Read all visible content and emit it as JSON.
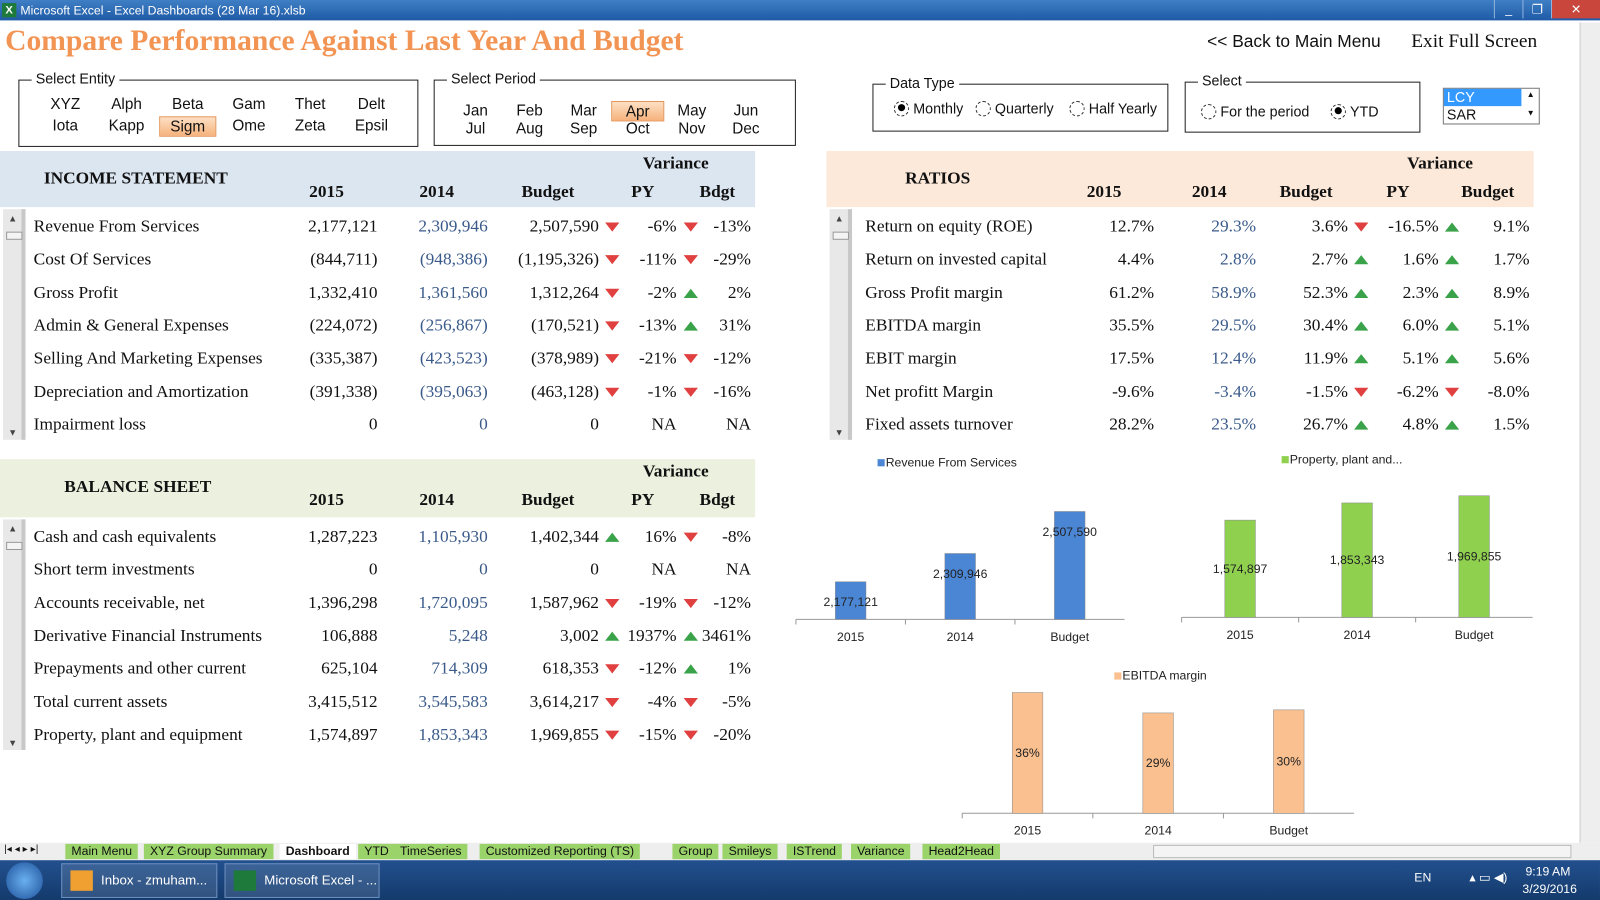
{
  "window": {
    "title": "Microsoft Excel - Excel Dashboards (28 Mar 16).xlsb",
    "minimize": "_",
    "restore": "❐",
    "close": "✕"
  },
  "page_title": "Compare Performance Against Last Year And Budget",
  "nav": {
    "back": "<< Back to Main Menu",
    "exit": "Exit Full Screen"
  },
  "entity": {
    "label": "Select Entity",
    "items": [
      "XYZ",
      "Alph",
      "Beta",
      "Gam",
      "Thet",
      "Delt",
      "Iota",
      "Kapp",
      "Sigm",
      "Ome",
      "Zeta",
      "Epsil"
    ],
    "selected": "Sigm"
  },
  "period": {
    "label": "Select Period",
    "items": [
      "Jan",
      "Feb",
      "Mar",
      "Apr",
      "May",
      "Jun",
      "Jul",
      "Aug",
      "Sep",
      "Oct",
      "Nov",
      "Dec"
    ],
    "selected": "Apr"
  },
  "data_type": {
    "label": "Data Type",
    "options": [
      "Monthly",
      "Quarterly",
      "Half Yearly"
    ],
    "selected": "Monthly"
  },
  "select": {
    "label": "Select",
    "options": [
      "For the period",
      "YTD"
    ],
    "selected": "YTD"
  },
  "currency": {
    "options": [
      "LCY",
      "SAR"
    ],
    "selected": "LCY"
  },
  "income": {
    "title": "INCOME STATEMENT",
    "variance": "Variance",
    "cols": [
      "2015",
      "2014",
      "Budget",
      "PY",
      "Bdgt"
    ],
    "band_color": "#dce6f1",
    "rows": [
      [
        "Revenue From Services",
        "2,177,121",
        "2,309,946",
        "2,507,590",
        "down",
        "-6%",
        "down",
        "-13%"
      ],
      [
        "Cost Of Services",
        "(844,711)",
        "(948,386)",
        "(1,195,326)",
        "down",
        "-11%",
        "down",
        "-29%"
      ],
      [
        "Gross Profit",
        "1,332,410",
        "1,361,560",
        "1,312,264",
        "down",
        "-2%",
        "up",
        "2%"
      ],
      [
        "Admin & General   Expenses",
        "(224,072)",
        "(256,867)",
        "(170,521)",
        "down",
        "-13%",
        "up",
        "31%"
      ],
      [
        "Selling And Marketing Expenses",
        "(335,387)",
        "(423,523)",
        "(378,989)",
        "down",
        "-21%",
        "down",
        "-12%"
      ],
      [
        "Depreciation and Amortization",
        "(391,338)",
        "(395,063)",
        "(463,128)",
        "down",
        "-1%",
        "down",
        "-16%"
      ],
      [
        "Impairment loss",
        "0",
        "0",
        "0",
        "",
        "NA",
        "",
        "NA"
      ]
    ]
  },
  "balance": {
    "title": "BALANCE SHEET",
    "variance": "Variance",
    "cols": [
      "2015",
      "2014",
      "Budget",
      "PY",
      "Bdgt"
    ],
    "band_color": "#ebf1de",
    "rows": [
      [
        "Cash and cash equivalents",
        "1,287,223",
        "1,105,930",
        "1,402,344",
        "up",
        "16%",
        "down",
        "-8%"
      ],
      [
        "Short term investments",
        "0",
        "0",
        "0",
        "",
        "NA",
        "",
        "NA"
      ],
      [
        "Accounts receivable, net",
        "1,396,298",
        "1,720,095",
        "1,587,962",
        "down",
        "-19%",
        "down",
        "-12%"
      ],
      [
        "Derivative Financial Instruments",
        "106,888",
        "5,248",
        "3,002",
        "up",
        "1937%",
        "up",
        "3461%"
      ],
      [
        "Prepayments and other current",
        "625,104",
        "714,309",
        "618,353",
        "down",
        "-12%",
        "up",
        "1%"
      ],
      [
        "Total current assets",
        "3,415,512",
        "3,545,583",
        "3,614,217",
        "down",
        "-4%",
        "down",
        "-5%"
      ],
      [
        "Property, plant and equipment",
        "1,574,897",
        "1,853,343",
        "1,969,855",
        "down",
        "-15%",
        "down",
        "-20%"
      ]
    ]
  },
  "ratios": {
    "title": "RATIOS",
    "variance": "Variance",
    "cols": [
      "2015",
      "2014",
      "Budget",
      "PY",
      "Budget"
    ],
    "band_color": "#fde9d9",
    "rows": [
      [
        "Return on equity (ROE)",
        "12.7%",
        "29.3%",
        "3.6%",
        "down",
        "-16.5%",
        "up",
        "9.1%"
      ],
      [
        "Return on invested capital",
        "4.4%",
        "2.8%",
        "2.7%",
        "up",
        "1.6%",
        "up",
        "1.7%"
      ],
      [
        "Gross Profit margin",
        "61.2%",
        "58.9%",
        "52.3%",
        "up",
        "2.3%",
        "up",
        "8.9%"
      ],
      [
        "EBITDA margin",
        "35.5%",
        "29.5%",
        "30.4%",
        "up",
        "6.0%",
        "up",
        "5.1%"
      ],
      [
        "EBIT margin",
        "17.5%",
        "12.4%",
        "11.9%",
        "up",
        "5.1%",
        "up",
        "5.6%"
      ],
      [
        "Net profitt Margin",
        "-9.6%",
        "-3.4%",
        "-1.5%",
        "down",
        "-6.2%",
        "down",
        "-8.0%"
      ],
      [
        "Fixed assets turnover",
        "28.2%",
        "23.5%",
        "26.7%",
        "up",
        "4.8%",
        "up",
        "1.5%"
      ]
    ]
  },
  "chart_data": [
    {
      "type": "bar",
      "categories": [
        "2015",
        "2014",
        "Budget"
      ],
      "series": [
        {
          "name": "Revenue From Services",
          "values": [
            2177121,
            2309946,
            2507590
          ]
        }
      ],
      "data_labels": [
        "2,177,121",
        "2,309,946",
        "2,507,590"
      ],
      "ylim": [
        2000000,
        2600000
      ],
      "color": "#4a86d4",
      "legend": "top"
    },
    {
      "type": "bar",
      "categories": [
        "2015",
        "2014",
        "Budget"
      ],
      "series": [
        {
          "name": "Property, plant and...",
          "values": [
            1574897,
            1853343,
            1969855
          ]
        }
      ],
      "data_labels": [
        "1,574,897",
        "1,853,343",
        "1,969,855"
      ],
      "ylim": [
        0,
        2000000
      ],
      "color": "#8fd14f",
      "legend": "top"
    },
    {
      "type": "bar",
      "categories": [
        "2015",
        "2014",
        "Budget"
      ],
      "series": [
        {
          "name": "EBITDA margin",
          "values": [
            35.5,
            29.5,
            30.4
          ]
        }
      ],
      "data_labels": [
        "36%",
        "29%",
        "30%"
      ],
      "ylim": [
        0,
        36
      ],
      "color": "#fac090",
      "legend": "top"
    }
  ],
  "sheet_tabs": [
    "Main Menu",
    "XYZ Group Summary",
    "Dashboard",
    "YTD",
    "TimeSeries",
    "Customized Reporting (TS)",
    "Group",
    "Smileys",
    "ISTrend",
    "Variance",
    "Head2Head"
  ],
  "active_tab": "Dashboard",
  "taskbar": {
    "items": [
      "Inbox - zmuham...",
      "Microsoft Excel - ..."
    ],
    "lang": "EN",
    "time": "9:19 AM",
    "date": "3/29/2016"
  }
}
